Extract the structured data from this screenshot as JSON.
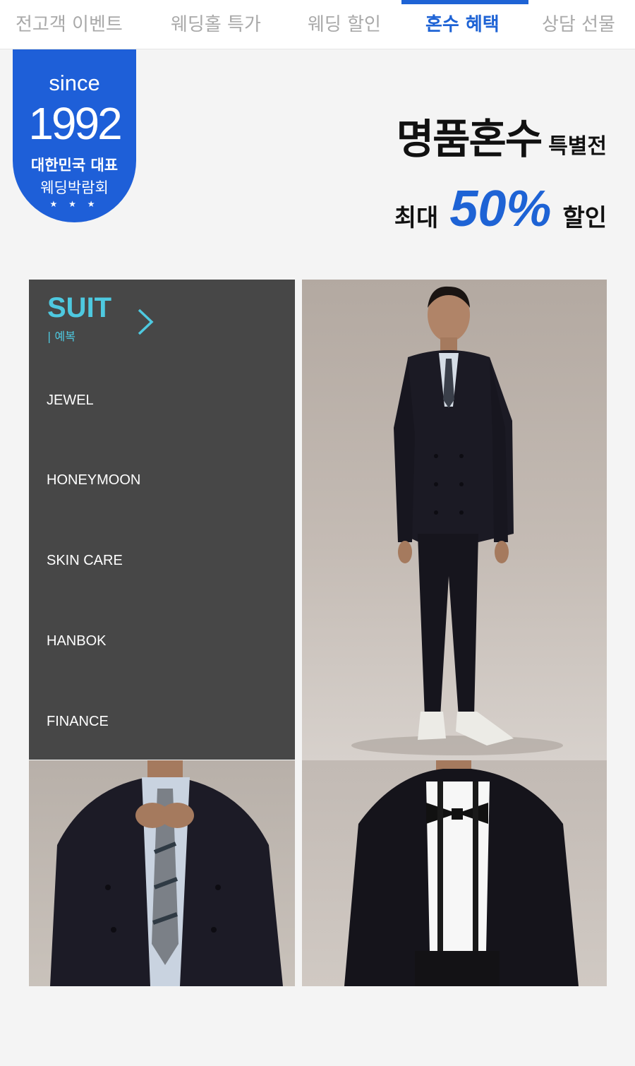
{
  "nav": {
    "tabs": [
      {
        "label": "전고객 이벤트"
      },
      {
        "label": "웨딩홀 특가"
      },
      {
        "label": "웨딩 할인"
      },
      {
        "label": "혼수 혜택"
      },
      {
        "label": "상담 선물"
      }
    ],
    "active_index": 3
  },
  "badge": {
    "since": "since",
    "year": "1992",
    "line1": "대한민국 대표",
    "line2": "웨딩박람회",
    "stars": "★ ★ ★"
  },
  "headline": {
    "main": "명품혼수",
    "sub": "특별전",
    "promo_pre": "최대",
    "promo_value": "50%",
    "promo_post": "할인"
  },
  "menu": {
    "active": {
      "label": "SUIT",
      "sublabel": "| 예복"
    },
    "items": [
      {
        "label": "JEWEL"
      },
      {
        "label": "HONEYMOON"
      },
      {
        "label": "SKIN CARE"
      },
      {
        "label": "HANBOK"
      },
      {
        "label": "FINANCE"
      }
    ]
  },
  "colors": {
    "accent": "#1e63d5",
    "menu_bg": "#474747",
    "menu_active": "#4ec9e0",
    "page_bg": "#f4f4f4"
  }
}
